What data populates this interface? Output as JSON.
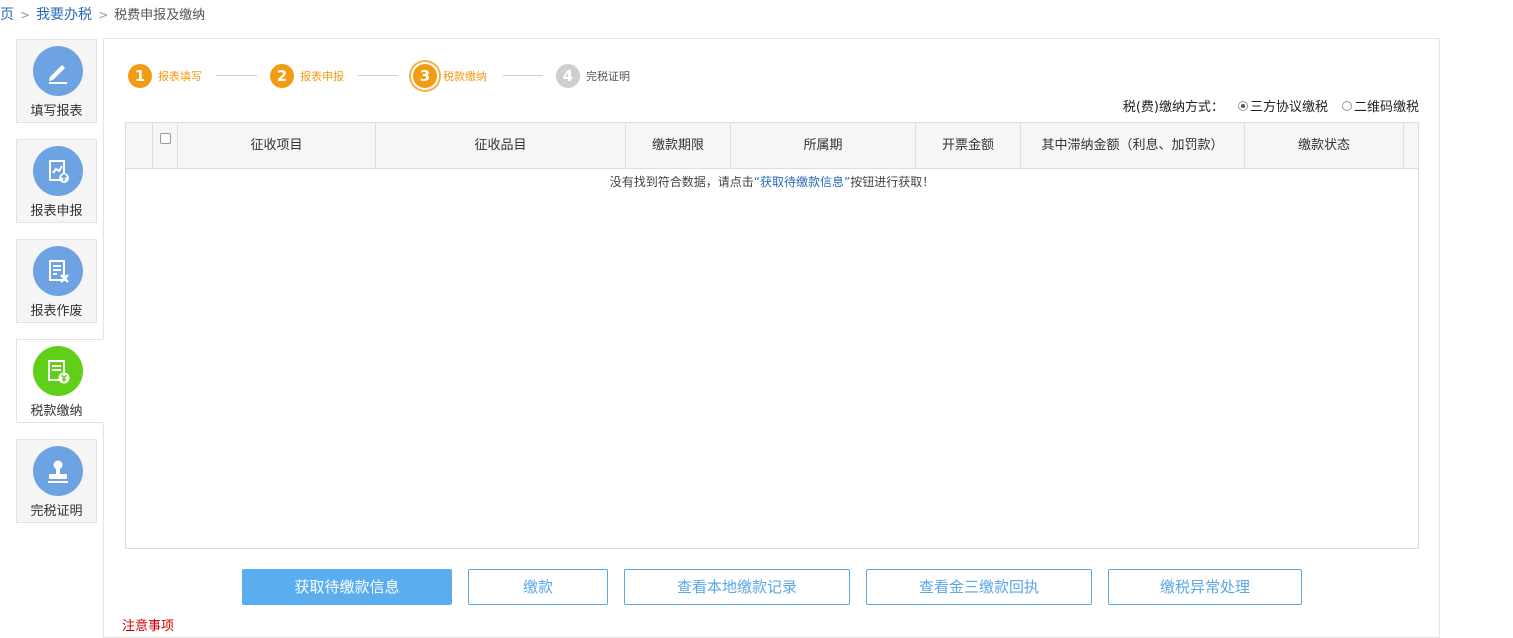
{
  "breadcrumb": {
    "home": "页",
    "section": "我要办税",
    "current": "税费申报及缴纳"
  },
  "nav": [
    {
      "label": "填写报表",
      "icon": "pencil-icon"
    },
    {
      "label": "报表申报",
      "icon": "report-upload-icon"
    },
    {
      "label": "报表作废",
      "icon": "report-void-icon"
    },
    {
      "label": "税款缴纳",
      "icon": "tax-payment-icon",
      "active": true
    },
    {
      "label": "完税证明",
      "icon": "stamp-icon"
    }
  ],
  "steps": [
    {
      "num": "1",
      "label": "报表填写",
      "state": "done"
    },
    {
      "num": "2",
      "label": "报表申报",
      "state": "done"
    },
    {
      "num": "3",
      "label": "税款缴纳",
      "state": "current"
    },
    {
      "num": "4",
      "label": "完税证明",
      "state": "todo"
    }
  ],
  "paymethod": {
    "label": "税(费)缴纳方式：",
    "options": [
      "三方协议缴税",
      "二维码缴税"
    ],
    "selected": 0
  },
  "table": {
    "columns": [
      "征收项目",
      "征收品目",
      "缴款期限",
      "所属期",
      "开票金额",
      "其中滞纳金额（利息、加罚款）",
      "缴款状态"
    ],
    "empty": {
      "prefix": "没有找到符合数据，请点击",
      "link": "“获取待缴款信息”",
      "suffix": "按钮进行获取！"
    }
  },
  "buttons": [
    "获取待缴款信息",
    "缴款",
    "查看本地缴款记录",
    "查看金三缴款回执",
    "缴税异常处理"
  ],
  "note": "注意事项",
  "colors": {
    "accent": "#5aaef0",
    "step": "#f39c12",
    "active_nav": "#5fcf1a",
    "nav_icon": "#6ea3e3"
  }
}
